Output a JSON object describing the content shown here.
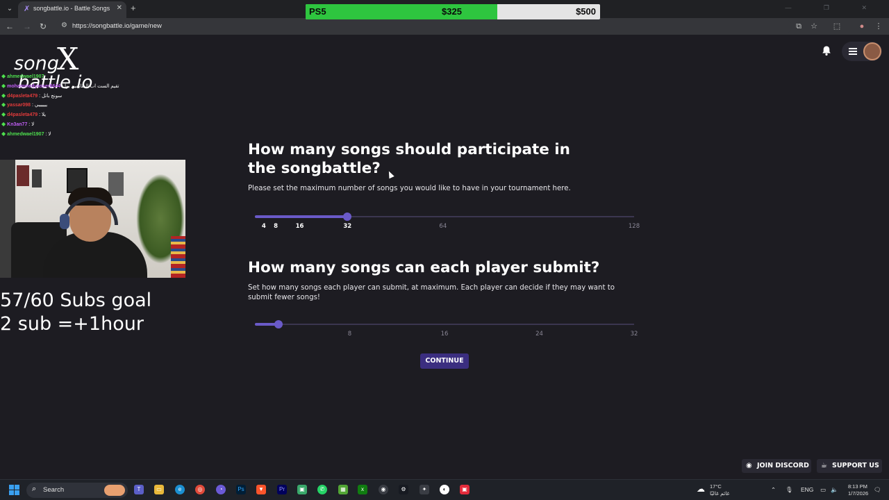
{
  "browser": {
    "tab_title": "songbattle.io - Battle Songs ag...",
    "url": "https://songbattle.io/game/new"
  },
  "goal_bar": {
    "label": "PS5",
    "current": "$325",
    "target": "$500",
    "progress": 0.65,
    "fill_color": "#2ec53f"
  },
  "logo": {
    "part1": "song",
    "part2": "battle.io"
  },
  "chat": [
    {
      "user": "ahmedwael1907",
      "text": "",
      "color": "#4ee04e"
    },
    {
      "user": "mohammedyasser6644",
      "text": ": تقيم الست اب المتابعين بوا",
      "color": "#c15ef5"
    },
    {
      "user": "d4pasleta479",
      "text": ": سونج باتل",
      "color": "#e23b3b"
    },
    {
      "user": "yassar098",
      "text": ": ييييييي",
      "color": "#e23b3b"
    },
    {
      "user": "d4pasleta479",
      "text": ": يلا",
      "color": "#e23b3b"
    },
    {
      "user": "Kn3an77",
      "text": ": لا",
      "color": "#c15ef5"
    },
    {
      "user": "ahmedwael1907",
      "text": ": لا",
      "color": "#4ee04e"
    }
  ],
  "subgoal": {
    "line1": "57/60 Subs goal",
    "line2": "2 sub =+1hour"
  },
  "question1": {
    "title": "How many songs should participate in the songbattle?",
    "description": "Please set the maximum number of songs you would like to have in your tournament here.",
    "slider": {
      "min": 1,
      "max": 128,
      "value": 32,
      "ticks": [
        4,
        8,
        16,
        32,
        64,
        128
      ],
      "tick_labels": [
        "4",
        "8",
        "16",
        "32",
        "64",
        "128"
      ]
    }
  },
  "question2": {
    "title": "How many songs can each player submit?",
    "description": "Set how many songs each player can submit, at maximum. Each player can decide if they may want to submit fewer songs!",
    "slider": {
      "min": 0,
      "max": 32,
      "value": 2,
      "ticks": [
        8,
        16,
        24,
        32
      ],
      "tick_labels": [
        "8",
        "16",
        "24",
        "32"
      ]
    }
  },
  "continue_label": "CONTINUE",
  "footer": {
    "discord_label": "JOIN DISCORD",
    "support_label": "SUPPORT US"
  },
  "taskbar": {
    "search_label": "Search",
    "weather_temp": "17°C",
    "weather_desc": "غائم غالبًا",
    "lang": "ENG",
    "time": "8:13 PM",
    "date": "1/7/2026"
  },
  "colors": {
    "accent": "#6a5ac8",
    "background": "#1d1c22",
    "button": "#3b2e80"
  }
}
